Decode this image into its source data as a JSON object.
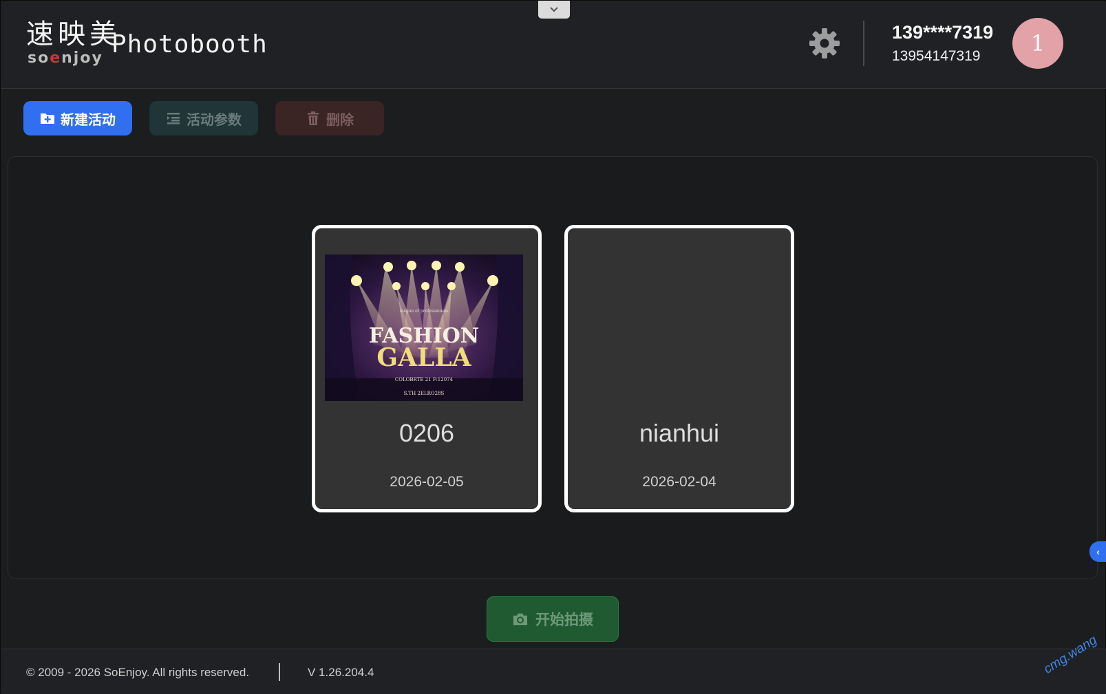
{
  "header": {
    "logo_cn": "速映美",
    "logo_en_prefix": "so",
    "logo_en_e": "e",
    "logo_en_suffix": "njoy",
    "app_name": "Photobooth",
    "user_masked": "139****7319",
    "user_phone": "13954147319",
    "avatar_text": "1"
  },
  "toolbar": {
    "new_label": "新建活动",
    "params_label": "活动参数",
    "delete_label": "删除"
  },
  "events": [
    {
      "name": "0206",
      "date": "2026-02-05",
      "poster": {
        "small_line": "league of professionals",
        "title_1": "FASHION",
        "title_2": "GALLA",
        "line_1": "COLOBRTE 21 F:12074",
        "line_2": "S.TH 2ELRO28S"
      }
    },
    {
      "name": "nianhui",
      "date": "2026-02-04"
    }
  ],
  "start_label": "开始拍摄",
  "footer": {
    "copyright": "© 2009 - 2026 SoEnjoy. All rights reserved.",
    "version": "V 1.26.204.4"
  },
  "watermark": "cmg.wang",
  "colors": {
    "primary": "#2f6ff0",
    "avatar": "#e3a1a8",
    "start": "#1f5a31",
    "brand_e": "#c23a3a"
  }
}
